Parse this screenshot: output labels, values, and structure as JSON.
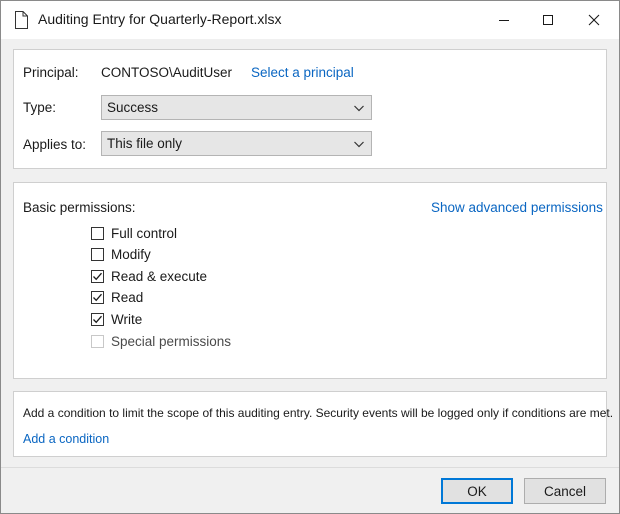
{
  "window": {
    "title": "Auditing Entry for Quarterly-Report.xlsx"
  },
  "principal": {
    "label": "Principal:",
    "value": "CONTOSO\\AuditUser",
    "select_link": "Select a principal"
  },
  "type": {
    "label": "Type:",
    "value": "Success"
  },
  "applies_to": {
    "label": "Applies to:",
    "value": "This file only"
  },
  "permissions": {
    "label": "Basic permissions:",
    "advanced_link": "Show advanced permissions",
    "items": [
      {
        "label": "Full control",
        "checked": false,
        "enabled": true
      },
      {
        "label": "Modify",
        "checked": false,
        "enabled": true
      },
      {
        "label": "Read & execute",
        "checked": true,
        "enabled": true
      },
      {
        "label": "Read",
        "checked": true,
        "enabled": true
      },
      {
        "label": "Write",
        "checked": true,
        "enabled": true
      },
      {
        "label": "Special permissions",
        "checked": false,
        "enabled": false
      }
    ]
  },
  "condition": {
    "description": "Add a condition to limit the scope of this auditing entry.  Security events will be logged only if conditions are met.",
    "add_link": "Add a condition"
  },
  "buttons": {
    "ok": "OK",
    "cancel": "Cancel"
  },
  "colors": {
    "link": "#0a66c2",
    "ok_border": "#0078d7"
  }
}
